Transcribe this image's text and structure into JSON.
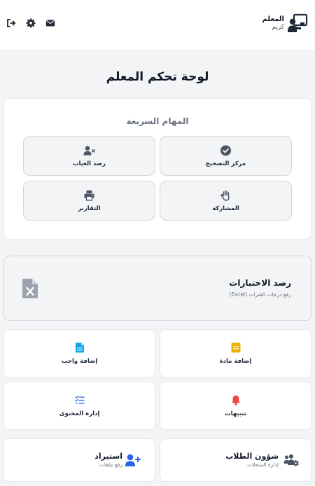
{
  "header": {
    "brand_title": "المعلم",
    "brand_subtitle": "كريم",
    "icons": [
      "teacher-board-icon",
      "envelope-icon",
      "gear-icon",
      "sign-out-icon"
    ]
  },
  "page": {
    "title": "لوحة تحكم المعلم"
  },
  "quick_tasks": {
    "title": "المهام السريعة",
    "items": [
      {
        "label": "مركز التصحيح",
        "icon": "check-circle-icon"
      },
      {
        "label": "رصد الغياب",
        "icon": "user-x-icon"
      },
      {
        "label": "المشاركة",
        "icon": "raised-hand-icon"
      },
      {
        "label": "التقارير",
        "icon": "printer-icon"
      }
    ]
  },
  "exams": {
    "title": "رصد الاختبارات",
    "subtitle": "رفع درجات الفترات (Excel)",
    "icon": "excel-file-icon"
  },
  "tiles": [
    {
      "label": "إضافة مادة",
      "icon": "subject-icon",
      "color": "#eab308"
    },
    {
      "label": "إضافة واجب",
      "icon": "homework-file-icon",
      "color": "#0ea5e9"
    },
    {
      "label": "تنبيهات",
      "icon": "bell-icon",
      "color": "#ef4444"
    },
    {
      "label": "إدارة المحتوى",
      "icon": "list-check-icon",
      "color": "#2563eb"
    }
  ],
  "wide_tiles": [
    {
      "title": "شؤون الطلاب",
      "subtitle": "إدارة السجلات",
      "icon": "users-gear-icon"
    },
    {
      "title": "استيراد",
      "subtitle": "رفع ملفات",
      "icon": "user-plus-icon",
      "color": "#2563eb"
    }
  ]
}
